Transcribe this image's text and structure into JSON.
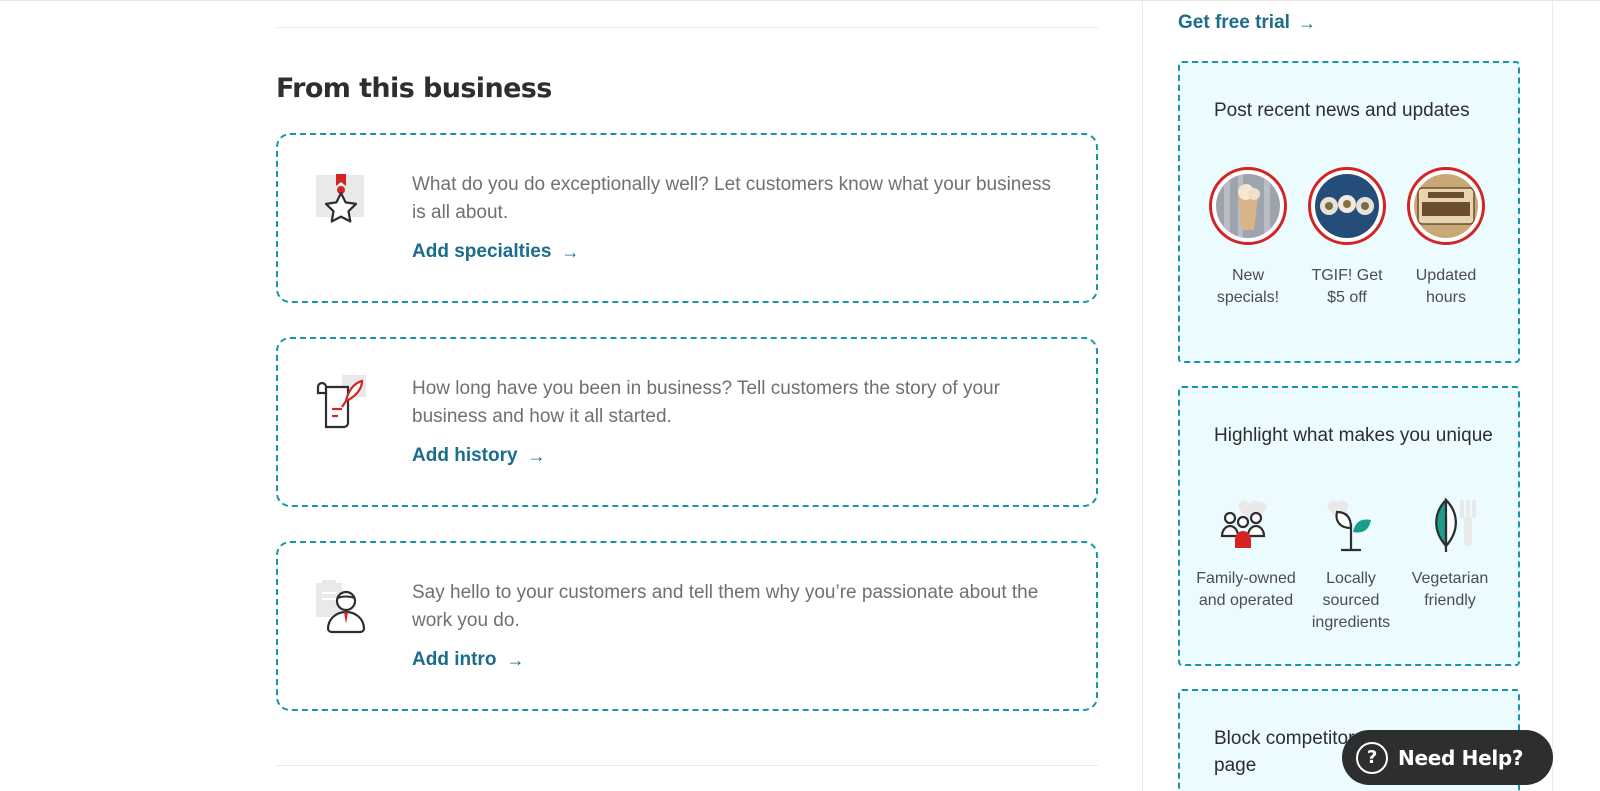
{
  "main": {
    "section_title": "From this business",
    "cards": [
      {
        "icon": "specialty-star-icon",
        "text": "What do you do exceptionally well? Let customers know what your business is all about.",
        "link": "Add specialties"
      },
      {
        "icon": "history-scroll-icon",
        "text": "How long have you been in business? Tell customers the story of your business and how it all started.",
        "link": "Add history"
      },
      {
        "icon": "business-owner-icon",
        "text": "Say hello to your customers and tell them why you’re passionate about the work you do.",
        "link": "Add intro"
      }
    ]
  },
  "sidebar": {
    "trial_link": "Get free trial",
    "news_card": {
      "title": "Post recent news and updates",
      "items": [
        {
          "label": "New specials!",
          "image": "milkshake-photo"
        },
        {
          "label": "TGIF! Get $5 off",
          "image": "sushi-photo"
        },
        {
          "label": "Updated hours",
          "image": "open-sign-photo"
        }
      ]
    },
    "unique_card": {
      "title": "Highlight what makes you unique",
      "items": [
        {
          "label": "Family-owned and operated",
          "icon": "family-icon"
        },
        {
          "label": "Locally sourced ingredients",
          "icon": "sprout-icon"
        },
        {
          "label": "Vegetarian friendly",
          "icon": "leaf-icon"
        }
      ]
    },
    "block_card": {
      "title": "Block competitors’ ads on your page"
    }
  },
  "help_button": {
    "label": "Need Help?"
  },
  "colors": {
    "accent": "#1c6c8c",
    "dashed_border": "#1a93ad",
    "promo_bg": "#ebfbfe",
    "brand_red": "#d32323"
  }
}
